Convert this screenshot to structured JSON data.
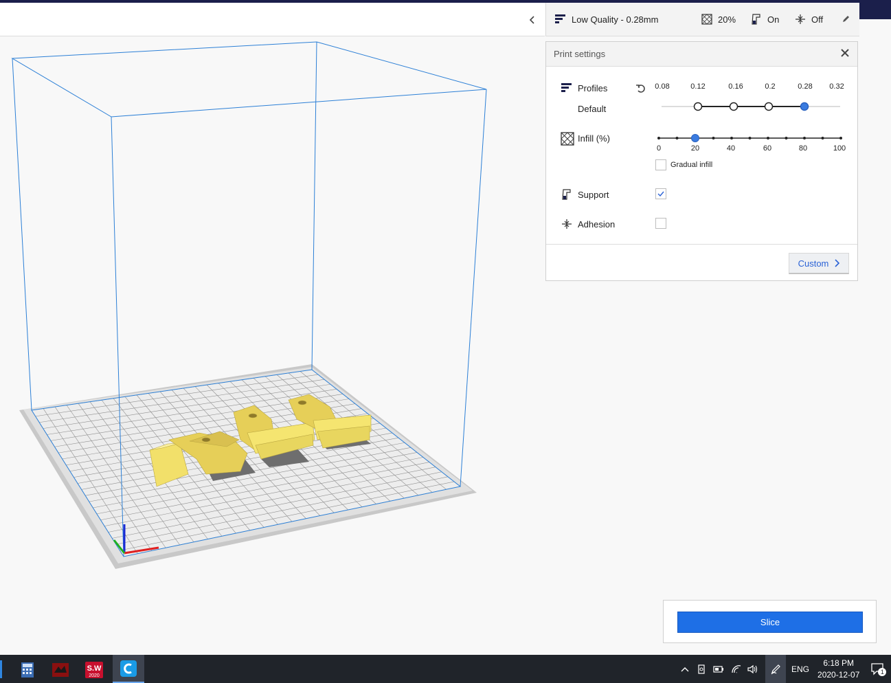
{
  "topbar": {
    "profile_label": "Low Quality - 0.28mm",
    "infill_summary": "20%",
    "support_summary": "On",
    "adhesion_summary": "Off"
  },
  "print_settings": {
    "title": "Print settings",
    "profiles_label": "Profiles",
    "profile_name": "Default",
    "layer_heights": [
      "0.08",
      "0.12",
      "0.16",
      "0.2",
      "0.28",
      "0.32"
    ],
    "selected_layer_height": "0.28",
    "infill_label": "Infill (%)",
    "infill_ticks": [
      "0",
      "20",
      "40",
      "60",
      "80",
      "100"
    ],
    "infill_value": 20,
    "gradual_infill_label": "Gradual infill",
    "gradual_infill_checked": false,
    "support_label": "Support",
    "support_checked": true,
    "adhesion_label": "Adhesion",
    "adhesion_checked": false,
    "custom_label": "Custom"
  },
  "slice": {
    "button_label": "Slice"
  },
  "taskbar": {
    "language": "ENG",
    "time": "6:18 PM",
    "date": "2020-12-07",
    "notification_count": "1",
    "solidworks_badge": "2020"
  },
  "colors": {
    "accent": "#1e6fe6",
    "slider_selected": "#3a7be0",
    "build_volume_lines": "#2b7fd6",
    "model": "#f2e06a",
    "taskbar": "#20242a",
    "header_stripe": "#1b1f4b"
  }
}
